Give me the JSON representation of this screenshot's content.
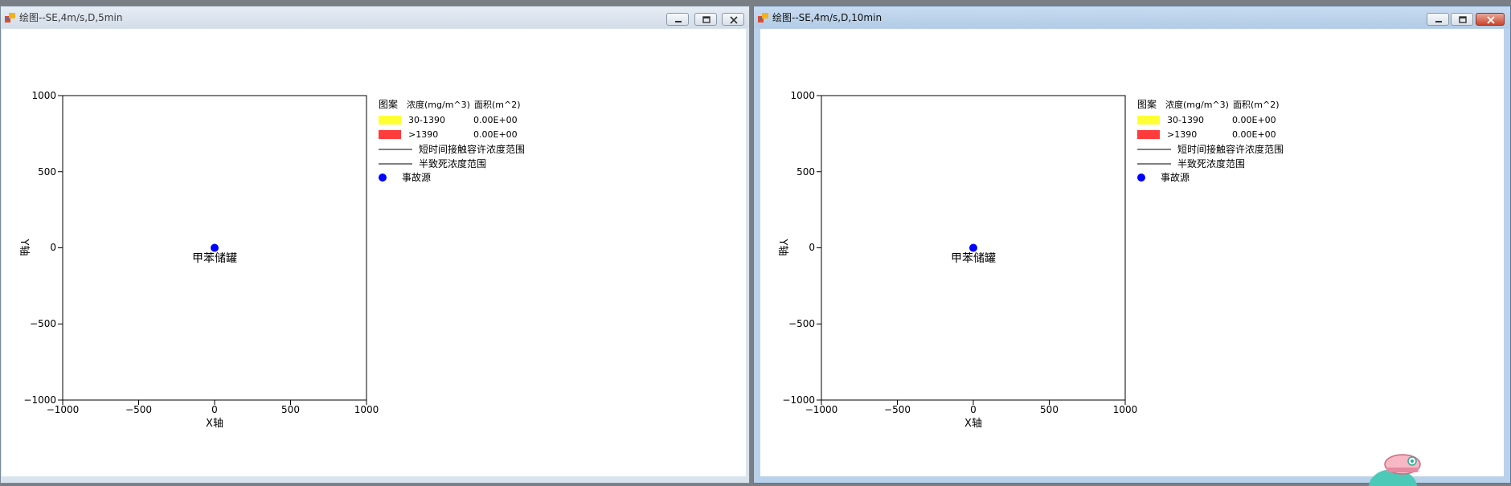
{
  "windows": [
    {
      "title": "绘图--SE,4m/s,D,5min",
      "plot": {
        "ylabel": "Y轴",
        "xlabel": "X轴",
        "y_ticks": [
          "1000",
          "500",
          "0",
          "−500",
          "−1000"
        ],
        "x_ticks": [
          "−1000",
          "−500",
          "0",
          "500",
          "1000"
        ],
        "source_label": "甲苯储罐",
        "legend": {
          "headers": [
            "图案",
            "浓度(mg/m^3)",
            "面积(m^2)"
          ],
          "rows": [
            {
              "range": "30-1390",
              "area": "0.00E+00",
              "color": "#ffff33"
            },
            {
              "range": ">1390",
              "area": "0.00E+00",
              "color": "#ff3b3b"
            }
          ],
          "lines": [
            "短时间接触容许浓度范围",
            "半致死浓度范围"
          ],
          "source_entry": "事故源",
          "source_color": "#0000ff"
        }
      }
    },
    {
      "title": "绘图--SE,4m/s,D,10min",
      "plot": {
        "ylabel": "Y轴",
        "xlabel": "X轴",
        "y_ticks": [
          "1000",
          "500",
          "0",
          "−500",
          "−1000"
        ],
        "x_ticks": [
          "−1000",
          "−500",
          "0",
          "500",
          "1000"
        ],
        "source_label": "甲苯储罐",
        "legend": {
          "headers": [
            "图案",
            "浓度(mg/m^3)",
            "面积(m^2)"
          ],
          "rows": [
            {
              "range": "30-1390",
              "area": "0.00E+00",
              "color": "#ffff33"
            },
            {
              "range": ">1390",
              "area": "0.00E+00",
              "color": "#ff3b3b"
            }
          ],
          "lines": [
            "短时间接触容许浓度范围",
            "半致死浓度范围"
          ],
          "source_entry": "事故源",
          "source_color": "#0000ff"
        }
      }
    }
  ]
}
